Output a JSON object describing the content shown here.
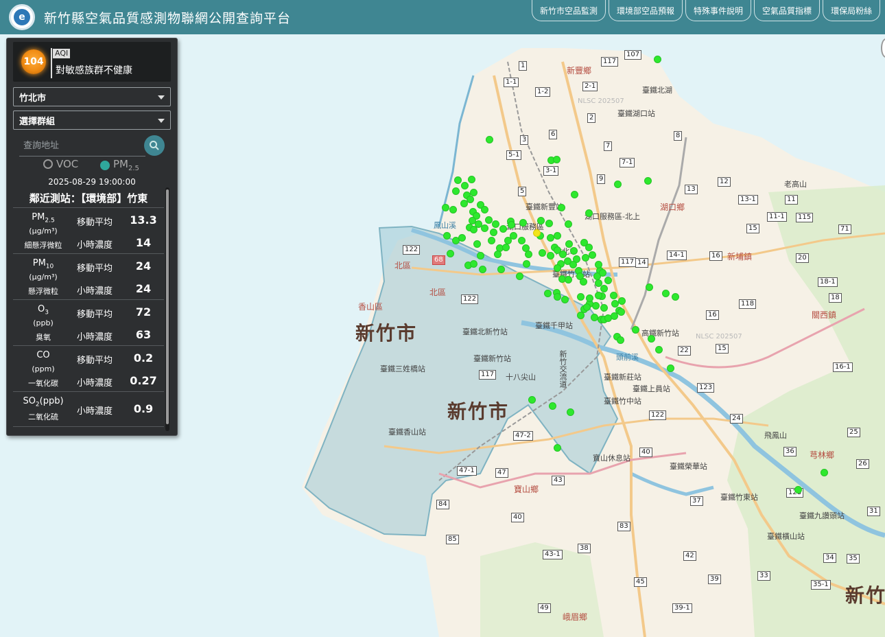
{
  "header": {
    "logo_text": "e",
    "title": "新竹縣空氣品質感測物聯網公開查詢平台",
    "nav": [
      "新竹市空品監測",
      "環境部空品預報",
      "特殊事件說明",
      "空氣品質指標",
      "環保局粉絲"
    ]
  },
  "panel": {
    "aqi": {
      "value": "104",
      "tag": "AQI",
      "status": "對敏感族群不健康",
      "color": "#f08c14"
    },
    "district_select": "竹北市",
    "group_select": "選擇群組",
    "search_placeholder": "查詢地址",
    "radio": {
      "voc": "VOC",
      "pm_prefix": "PM",
      "pm_sub": "2.5",
      "selected": "pm2.5"
    },
    "timestamp": "2025-08-29 19:00:00",
    "station": "鄰近測站：【環境部】竹東",
    "pollutants": [
      {
        "name": "PM",
        "sub": "2.5",
        "unit": "(µg/m³)",
        "desc": "細懸浮微粒",
        "m1_label": "移動平均",
        "m1_value": "13.3",
        "m2_label": "小時濃度",
        "m2_value": "14"
      },
      {
        "name": "PM",
        "sub": "10",
        "unit": "(µg/m³)",
        "desc": "懸浮微粒",
        "m1_label": "移動平均",
        "m1_value": "24",
        "m2_label": "小時濃度",
        "m2_value": "24"
      },
      {
        "name": "O",
        "sub": "3",
        "unit": "(ppb)",
        "desc": "臭氧",
        "m1_label": "移動平均",
        "m1_value": "72",
        "m2_label": "小時濃度",
        "m2_value": "63"
      },
      {
        "name": "CO",
        "sub": "",
        "unit": "(ppm)",
        "desc": "一氧化碳",
        "m1_label": "移動平均",
        "m1_value": "0.2",
        "m2_label": "小時濃度",
        "m2_value": "0.27"
      },
      {
        "name": "SO",
        "sub": "2",
        "name_suffix": "(ppb)",
        "desc": "二氧化硫",
        "m2_label": "小時濃度",
        "m2_value": "0.9"
      }
    ]
  },
  "map": {
    "big_labels": [
      "新竹市",
      "新竹市",
      "新竹"
    ],
    "towns": [
      "新豐鄉",
      "湖口鄉",
      "新埔鎮",
      "關西鎮",
      "芎林鄉",
      "寶山鄉",
      "峨眉鄉",
      "北區",
      "北區",
      "香山區"
    ],
    "places": [
      "臺鐵北湖",
      "臺鐵湖口站",
      "臺鐵新豐站",
      "湖口服務區-北上",
      "湖口服務區",
      "竹北市",
      "臺鐵竹北站",
      "臺鐵北新竹站",
      "臺鐵千甲站",
      "臺鐵新竹站",
      "臺鐵三姓橋站",
      "十八尖山",
      "新竹交流道",
      "臺鐵新莊站",
      "臺鐵竹中站",
      "臺鐵上員站",
      "高鐵新竹站",
      "臺鐵榮華站",
      "臺鐵竹東站",
      "臺鐵九讚頭站",
      "臺鐵橫山站",
      "飛鳳山",
      "老高山",
      "寶山休息站",
      "臺鐵香山站",
      "鳳山溪",
      "頭前溪",
      "NLSC 202507",
      "NLSC 202507"
    ],
    "roads": [
      "107",
      "117",
      "1",
      "1-1",
      "1-2",
      "2-1",
      "2",
      "3",
      "5-1",
      "3-1",
      "6",
      "7",
      "7-1",
      "8",
      "9",
      "5",
      "13",
      "12",
      "13-1",
      "11",
      "11-1",
      "115",
      "15",
      "71",
      "14",
      "14-1",
      "20",
      "18-1",
      "18",
      "117",
      "118",
      "16",
      "15",
      "16-1",
      "122",
      "22",
      "123",
      "24",
      "25",
      "26",
      "36",
      "40",
      "43",
      "47",
      "47-1",
      "47-2",
      "84",
      "40",
      "85",
      "43-1",
      "38",
      "42",
      "37",
      "39",
      "33",
      "35",
      "34",
      "35-1",
      "31",
      "49",
      "39-1",
      "45",
      "83",
      "122",
      "68",
      "128",
      "16",
      "122",
      "117"
    ],
    "sensors_green_count": 140,
    "sensors_yellow_count": 1,
    "colors": {
      "sensor_good": "#2ee82e",
      "sensor_moderate": "#f2e51b",
      "city_overlay": "#9fc9d6"
    }
  }
}
